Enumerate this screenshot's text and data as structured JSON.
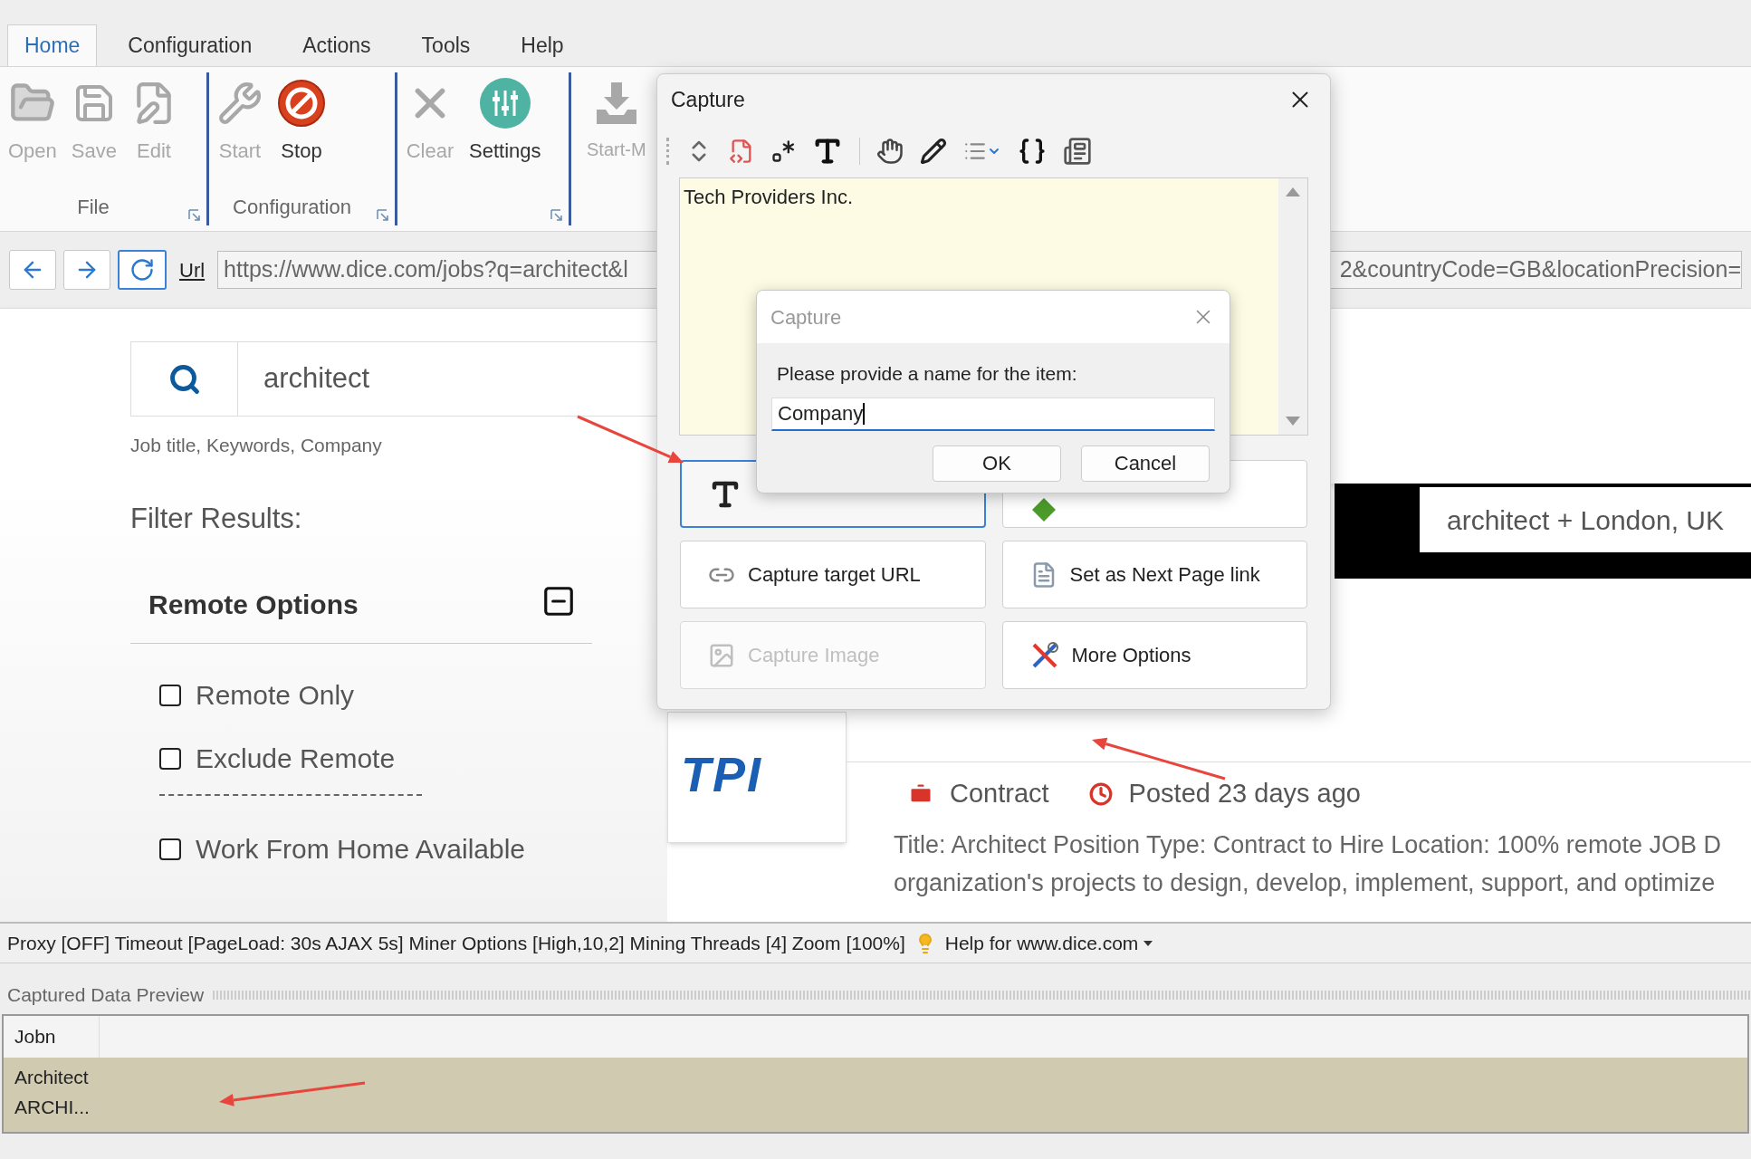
{
  "menu_tabs": [
    {
      "label": "Home",
      "selected": true
    },
    {
      "label": "Configuration",
      "selected": false
    },
    {
      "label": "Actions",
      "selected": false
    },
    {
      "label": "Tools",
      "selected": false
    },
    {
      "label": "Help",
      "selected": false
    }
  ],
  "ribbon": {
    "groups": [
      {
        "label": "File",
        "items": [
          {
            "kind": "open",
            "label": "Open",
            "disabled": true
          },
          {
            "kind": "save",
            "label": "Save",
            "disabled": true
          },
          {
            "kind": "edit",
            "label": "Edit",
            "disabled": true
          }
        ]
      },
      {
        "label": "Configuration",
        "items": [
          {
            "kind": "start",
            "label": "Start",
            "disabled": true
          },
          {
            "kind": "stop",
            "label": "Stop",
            "disabled": false
          }
        ]
      },
      {
        "items": [
          {
            "kind": "clear",
            "label": "Clear",
            "disabled": true
          },
          {
            "kind": "settings",
            "label": "Settings",
            "disabled": false
          }
        ]
      },
      {
        "items": [
          {
            "kind": "download",
            "label": "Start-M",
            "disabled": true
          }
        ]
      }
    ]
  },
  "address_bar": {
    "label": "Url",
    "url_start": "https://www.dice.com/jobs?q=architect&l",
    "url_end": "2&countryCode=GB&locationPrecision="
  },
  "page": {
    "search": {
      "value": "architect",
      "hint": "Job title, Keywords, Company"
    },
    "filter_title": "Filter Results:",
    "filter_section": {
      "title": "Remote Options",
      "expanded": true,
      "options": [
        {
          "kind": "checkbox",
          "label": "Remote Only",
          "checked": false
        },
        {
          "kind": "checkbox",
          "label": "Exclude Remote",
          "checked": false
        },
        {
          "kind": "separator"
        },
        {
          "kind": "checkbox",
          "label": "Work From Home Available",
          "checked": false
        }
      ]
    },
    "location_banner": "architect + London, UK",
    "job": {
      "logo_text": "TPI",
      "type": "Contract",
      "posted": "Posted 23 days ago",
      "description": [
        "Title: Architect Position Type: Contract to Hire Location: 100% remote JOB D",
        "organization's projects to design, develop, implement, support, and optimize"
      ]
    }
  },
  "status_bar": {
    "text": "Proxy [OFF] Timeout [PageLoad: 30s AJAX 5s] Miner Options [High,10,2] Mining Threads [4] Zoom [100%]",
    "help": "Help for www.dice.com"
  },
  "preview": {
    "title": "Captured Data Preview",
    "columns": [
      "Jobn"
    ],
    "rows": [
      [
        "Architect"
      ],
      [
        "ARCHI..."
      ]
    ]
  },
  "capture_dialog": {
    "title": "Capture",
    "captured_text": "Tech Providers Inc.",
    "actions": [
      {
        "kind": "text",
        "focused": true,
        "disabled": false
      },
      {
        "kind": "follow",
        "focused": false,
        "disabled": false
      },
      {
        "kind": "url",
        "label": "Capture target URL",
        "focused": false,
        "disabled": false
      },
      {
        "kind": "nextpage",
        "label": "Set as Next Page link",
        "focused": false,
        "disabled": false
      },
      {
        "kind": "image",
        "label": "Capture Image",
        "focused": false,
        "disabled": true
      },
      {
        "kind": "more",
        "label": "More Options",
        "focused": false,
        "disabled": false
      }
    ]
  },
  "name_dialog": {
    "title": "Capture",
    "prompt": "Please provide a name for the item:",
    "value": "Company",
    "buttons": [
      "OK",
      "Cancel"
    ]
  }
}
